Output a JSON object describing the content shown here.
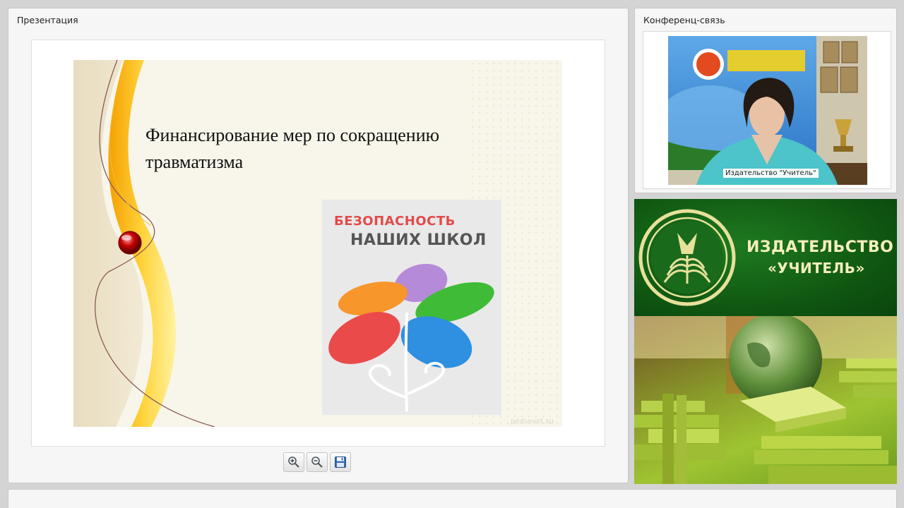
{
  "presentation": {
    "panel_title": "Презентация",
    "slide": {
      "title": "Финансирование мер по сокращению травматизма",
      "logo_line1": "БЕЗОПАСНОСТЬ",
      "logo_line2": "НАШИХ ШКОЛ",
      "watermark": "pedsovet.su"
    },
    "toolbar": {
      "zoom_in_icon": "zoom-in-icon",
      "zoom_out_icon": "zoom-out-icon",
      "save_icon": "floppy-disk-icon"
    }
  },
  "conference": {
    "panel_title": "Конференц-связь",
    "video_label": "Издательство \"Учитель\""
  },
  "banner": {
    "name_line1": "ИЗДАТЕЛЬСТВО",
    "name_line2": "«УЧИТЕЛЬ»"
  },
  "colors": {
    "banner_green": "#0e5310",
    "title_red": "#e24a4a",
    "ribbon_yellow": "#f7c21b"
  }
}
